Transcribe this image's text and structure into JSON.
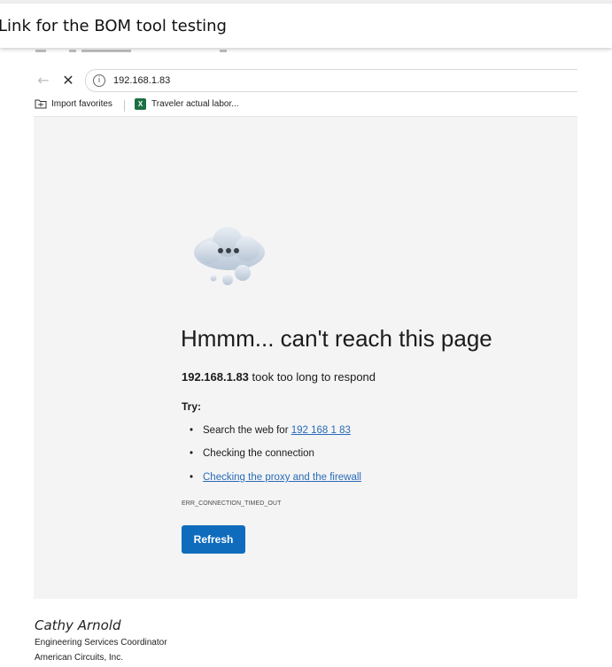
{
  "email": {
    "subject": "Link for the BOM tool testing"
  },
  "browser": {
    "address": "192.168.1.83",
    "favorites": [
      {
        "label": "Import favorites",
        "icon": "folder-icon"
      },
      {
        "label": "Traveler actual labor...",
        "icon": "excel-icon"
      }
    ]
  },
  "error_page": {
    "title": "Hmmm... can't reach this page",
    "host": "192.168.1.83",
    "message_suffix": " took too long to respond",
    "try_label": "Try:",
    "suggestion_search_prefix": "Search the web for ",
    "suggestion_search_link": "192 168 1 83",
    "suggestion_connection": "Checking the connection",
    "suggestion_proxy": "Checking the proxy and the firewall",
    "error_code": "ERR_CONNECTION_TIMED_OUT",
    "refresh_label": "Refresh",
    "accent_color": "#0f6cbd",
    "link_color": "#2a6bb8"
  },
  "signature": {
    "name": "Cathy Arnold",
    "title": "Engineering Services Coordinator",
    "company": "American Circuits, Inc."
  }
}
